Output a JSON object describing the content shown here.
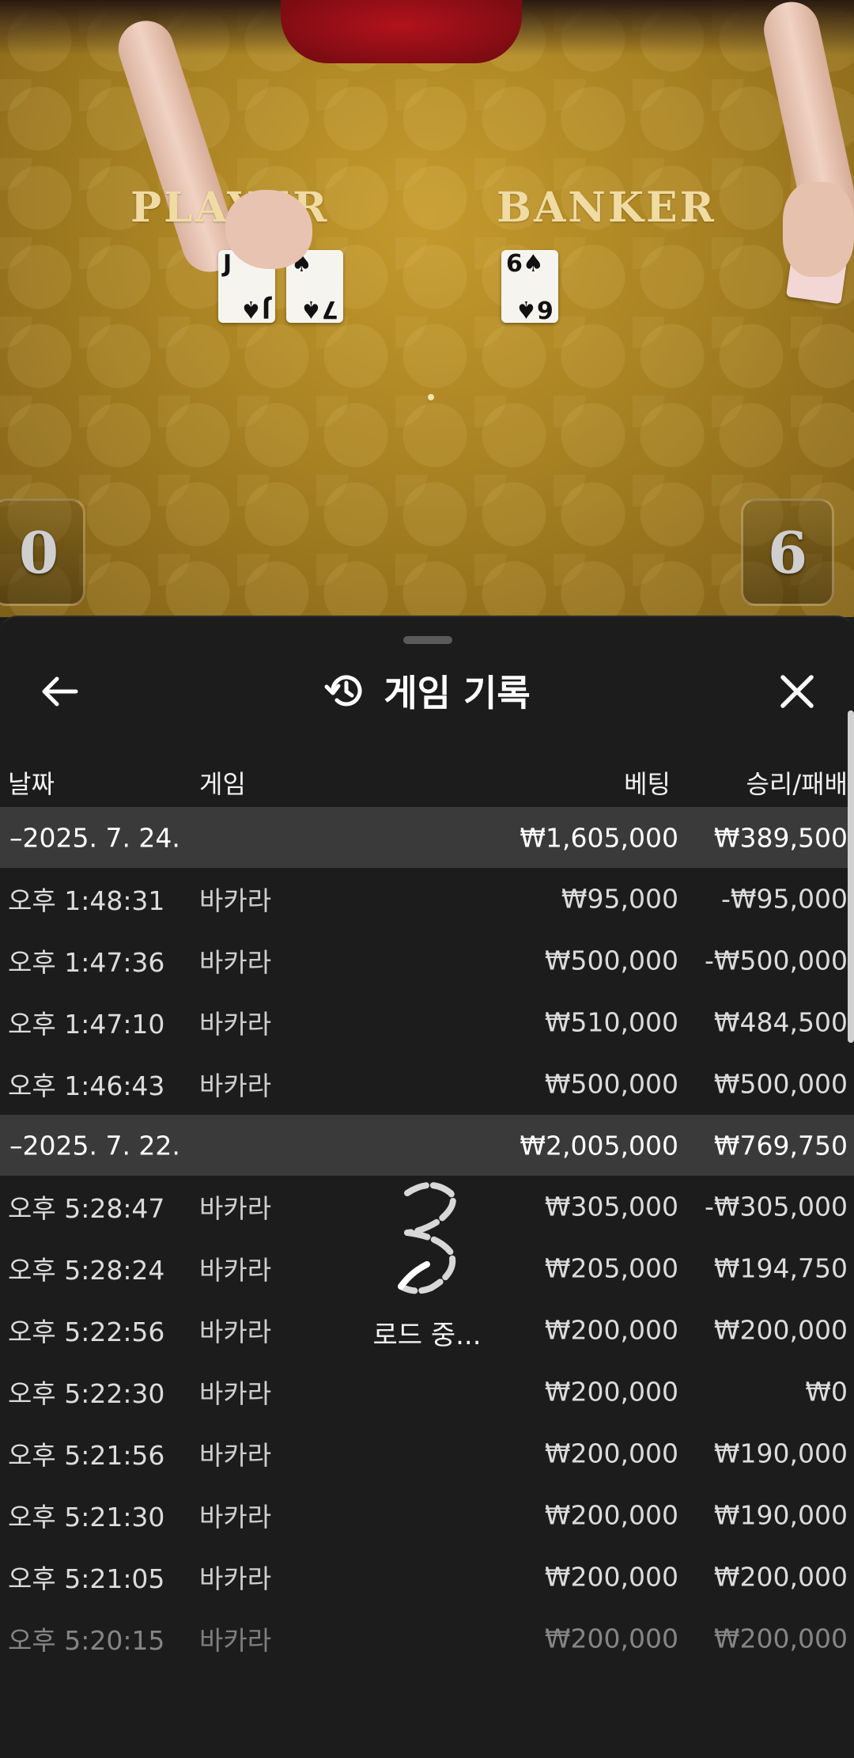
{
  "video": {
    "table_labels": {
      "player": "PLAYER",
      "banker": "BANKER"
    },
    "cards": {
      "player": [
        {
          "rank": "J",
          "suit": "♠"
        },
        {
          "rank": "7",
          "suit": "♠"
        }
      ],
      "banker": [
        {
          "rank": "6",
          "suit": "♠"
        }
      ]
    },
    "scores": {
      "player": "0",
      "banker": "6"
    }
  },
  "sheet": {
    "title": "게임 기록",
    "title_icon": "history-icon",
    "back_icon": "arrow-left-icon",
    "close_icon": "close-icon",
    "columns": {
      "date": "날짜",
      "game": "게임",
      "bet": "베팅",
      "win_loss": "승리/패배"
    },
    "groups": [
      {
        "date": "–2025. 7. 24.",
        "bet_total": "₩1,605,000",
        "win_total": "₩389,500",
        "rows": [
          {
            "time": "오후 1:48:31",
            "game": "바카라",
            "bet": "₩95,000",
            "win": "-₩95,000"
          },
          {
            "time": "오후 1:47:36",
            "game": "바카라",
            "bet": "₩500,000",
            "win": "-₩500,000"
          },
          {
            "time": "오후 1:47:10",
            "game": "바카라",
            "bet": "₩510,000",
            "win": "₩484,500"
          },
          {
            "time": "오후 1:46:43",
            "game": "바카라",
            "bet": "₩500,000",
            "win": "₩500,000"
          }
        ]
      },
      {
        "date": "–2025. 7. 22.",
        "bet_total": "₩2,005,000",
        "win_total": "₩769,750",
        "rows": [
          {
            "time": "오후 5:28:47",
            "game": "바카라",
            "bet": "₩305,000",
            "win": "-₩305,000"
          },
          {
            "time": "오후 5:28:24",
            "game": "바카라",
            "bet": "₩205,000",
            "win": "₩194,750"
          },
          {
            "time": "오후 5:22:56",
            "game": "바카라",
            "bet": "₩200,000",
            "win": "₩200,000"
          },
          {
            "time": "오후 5:22:30",
            "game": "바카라",
            "bet": "₩200,000",
            "win": "₩0"
          },
          {
            "time": "오후 5:21:56",
            "game": "바카라",
            "bet": "₩200,000",
            "win": "₩190,000"
          },
          {
            "time": "오후 5:21:30",
            "game": "바카라",
            "bet": "₩200,000",
            "win": "₩190,000"
          },
          {
            "time": "오후 5:21:05",
            "game": "바카라",
            "bet": "₩200,000",
            "win": "₩200,000"
          },
          {
            "time": "오후 5:20:15",
            "game": "바카라",
            "bet": "₩200,000",
            "win": "₩200,000"
          }
        ]
      }
    ],
    "loading_text": "로드 중...",
    "loading_icon": "loading-spinner-icon"
  }
}
